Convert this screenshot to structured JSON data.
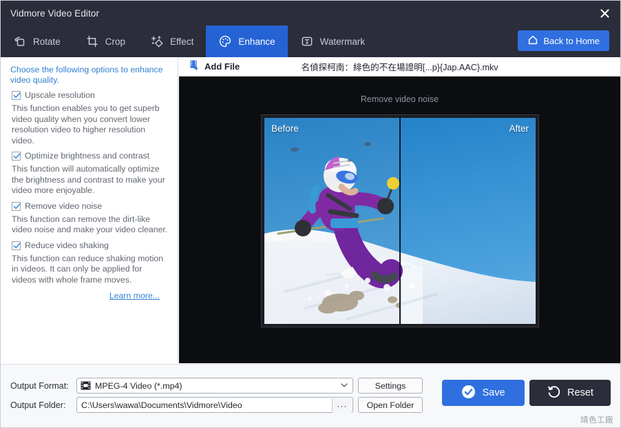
{
  "window": {
    "title": "Vidmore Video Editor",
    "close_icon": "close-icon"
  },
  "toolbar": {
    "items": [
      {
        "label": "Rotate",
        "icon": "rotate-icon",
        "active": false
      },
      {
        "label": "Crop",
        "icon": "crop-icon",
        "active": false
      },
      {
        "label": "Effect",
        "icon": "sparkle-icon",
        "active": false
      },
      {
        "label": "Enhance",
        "icon": "palette-icon",
        "active": true
      },
      {
        "label": "Watermark",
        "icon": "text-box-icon",
        "active": false
      }
    ],
    "back_home": {
      "label": "Back to Home",
      "icon": "home-icon"
    },
    "active_color": "#2563d4",
    "bar_color": "#2b2d3a"
  },
  "options_panel": {
    "hint": "Choose the following options to enhance video quality.",
    "options": [
      {
        "label": "Upscale resolution",
        "checked": true,
        "description": "This function enables you to get superb video quality when you convert lower resolution video to higher resolution video."
      },
      {
        "label": "Optimize brightness and contrast",
        "checked": true,
        "description": "This function will automatically optimize the brightness and contrast to make your video more enjoyable."
      },
      {
        "label": "Remove video noise",
        "checked": true,
        "description": "This function can remove the dirt-like video noise and make your video cleaner."
      },
      {
        "label": "Reduce video shaking",
        "checked": true,
        "description": "This function can reduce shaking motion in videos. It can only be applied for videos with whole frame moves."
      }
    ],
    "learn_more": "Learn more...",
    "link_color": "#2f7fd0"
  },
  "file_bar": {
    "add_file_label": "Add File",
    "add_file_icon": "add-film-icon",
    "file_name": "名偵探柯南：緋色的不在場證明[...p}{Jap.AAC}.mkv"
  },
  "preview": {
    "caption": "Remove video noise",
    "before_label": "Before",
    "after_label": "After",
    "background": "#0c0d11"
  },
  "output": {
    "format_label": "Output Format:",
    "format_value": "MPEG-4 Video (*.mp4)",
    "format_icon": "film-format-icon",
    "settings_label": "Settings",
    "folder_label": "Output Folder:",
    "folder_value": "C:\\Users\\wawa\\Documents\\Vidmore\\Video",
    "browse_label": "···",
    "open_folder_label": "Open Folder"
  },
  "actions": {
    "save_label": "Save",
    "save_icon": "check-circle-icon",
    "save_color": "#2f6fe0",
    "reset_label": "Reset",
    "reset_icon": "undo-icon",
    "reset_color": "#2b2d3a"
  },
  "watermark": "靖色工廠"
}
